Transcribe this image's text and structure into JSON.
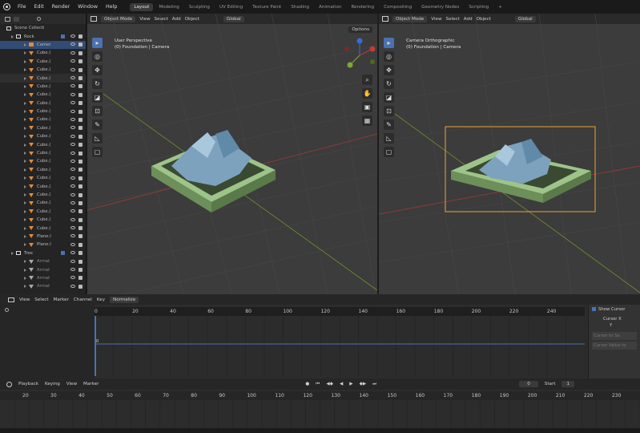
{
  "topbar": {
    "menus": [
      "File",
      "Edit",
      "Render",
      "Window",
      "Help"
    ],
    "workspaces": [
      "Layout",
      "Modeling",
      "Sculpting",
      "UV Editing",
      "Texture Paint",
      "Shading",
      "Animation",
      "Rendering",
      "Compositing",
      "Geometry Nodes",
      "Scripting"
    ],
    "add_tab": "+"
  },
  "outliner": {
    "scene_collection": "Scene Collecti",
    "collection": "Rock",
    "items": [
      "Camer",
      "Cube.(",
      "Cube.(",
      "Cube.(",
      "Cube.(",
      "Cube.(",
      "Cube.(",
      "Cube.(",
      "Cube.(",
      "Cube.(",
      "Cube.(",
      "Cube.(",
      "Cube.(",
      "Cube.(",
      "Cube.(",
      "Cube.(",
      "Cube.(",
      "Cube.(",
      "Cube.(",
      "Cube.(",
      "Cube.(",
      "Cube.(",
      "Cube.(",
      "Plane.l",
      "Plane.l"
    ],
    "collection2": "Tree",
    "items2": [
      "Armat",
      "Armat",
      "Armat",
      "Armat"
    ]
  },
  "viewport_left": {
    "mode": "Object Mode",
    "menus": [
      "View",
      "Select",
      "Add",
      "Object"
    ],
    "orientation": "Global",
    "options_label": "Options",
    "info_title": "User Perspective",
    "info_sub": "(0) Foundation | Camera"
  },
  "viewport_right": {
    "mode": "Object Mode",
    "menus": [
      "View",
      "Select",
      "Add",
      "Object"
    ],
    "orientation": "Global",
    "info_title": "Camera Orthographic",
    "info_sub": "(0) Foundation | Camera"
  },
  "dopesheet": {
    "menus": [
      "View",
      "Select",
      "Marker",
      "Channel",
      "Key"
    ],
    "interp": "Normalize",
    "ruler_ticks": [
      "0",
      "20",
      "40",
      "60",
      "80",
      "100",
      "120",
      "140",
      "160",
      "180",
      "200",
      "220",
      "240"
    ],
    "current_value": "0"
  },
  "side_panel": {
    "show_cursor": "Show Cursor",
    "cursor_x": "Cursor X",
    "y": "Y",
    "cursor_to_sel": "Cursor to Se",
    "cursor_value": "Cursor Value to"
  },
  "playback": {
    "playback": "Playback",
    "keying": "Keying",
    "view": "View",
    "marker": "Marker",
    "current_frame": "0",
    "start_label": "Start",
    "start_value": "1"
  },
  "timeline_ticks": [
    "20",
    "30",
    "40",
    "50",
    "60",
    "70",
    "80",
    "90",
    "100",
    "110",
    "120",
    "130",
    "140",
    "150",
    "160",
    "170",
    "180",
    "190",
    "200",
    "210",
    "220",
    "230"
  ],
  "colors": {
    "accent": "#4a72b0",
    "camera_frame": "#e8a33a",
    "x_axis": "#b33a3a",
    "y_axis": "#7fa832",
    "selection": "#324c73"
  }
}
